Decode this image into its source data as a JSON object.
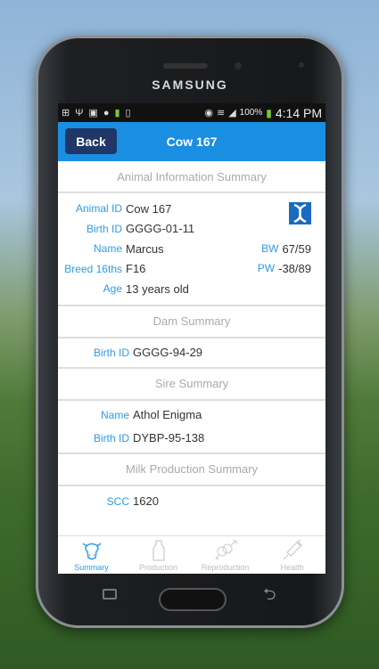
{
  "device": {
    "brand": "SAMSUNG"
  },
  "status_bar": {
    "battery": "100%",
    "time": "4:14 PM"
  },
  "header": {
    "back_label": "Back",
    "title": "Cow 167"
  },
  "animal_info": {
    "title": "Animal Information Summary",
    "rows": [
      {
        "label": "Animal ID",
        "value": "Cow 167"
      },
      {
        "label": "Birth ID",
        "value": "GGGG-01-11"
      },
      {
        "label": "Name",
        "value": "Marcus"
      },
      {
        "label": "Breed 16ths",
        "value": "F16"
      },
      {
        "label": "Age",
        "value": "13 years old"
      }
    ],
    "bw": {
      "label": "BW",
      "value": "67/59"
    },
    "pw": {
      "label": "PW",
      "value": "-38/89"
    }
  },
  "dam": {
    "title": "Dam Summary",
    "rows": [
      {
        "label": "Birth ID",
        "value": "GGGG-94-29"
      }
    ]
  },
  "sire": {
    "title": "Sire Summary",
    "rows": [
      {
        "label": "Name",
        "value": "Athol Enigma"
      },
      {
        "label": "Birth ID",
        "value": "DYBP-95-138"
      }
    ]
  },
  "milk": {
    "title": "Milk Production Summary",
    "rows": [
      {
        "label": "SCC",
        "value": "1620"
      }
    ]
  },
  "tabs": [
    {
      "label": "Summary",
      "icon": "cow-icon"
    },
    {
      "label": "Production",
      "icon": "milk-bottle-icon"
    },
    {
      "label": "Reproduction",
      "icon": "gender-icon"
    },
    {
      "label": "Health",
      "icon": "syringe-icon"
    }
  ],
  "colors": {
    "accent": "#1a8ee0",
    "back_button": "#1f3667",
    "label": "#2f9be8"
  }
}
